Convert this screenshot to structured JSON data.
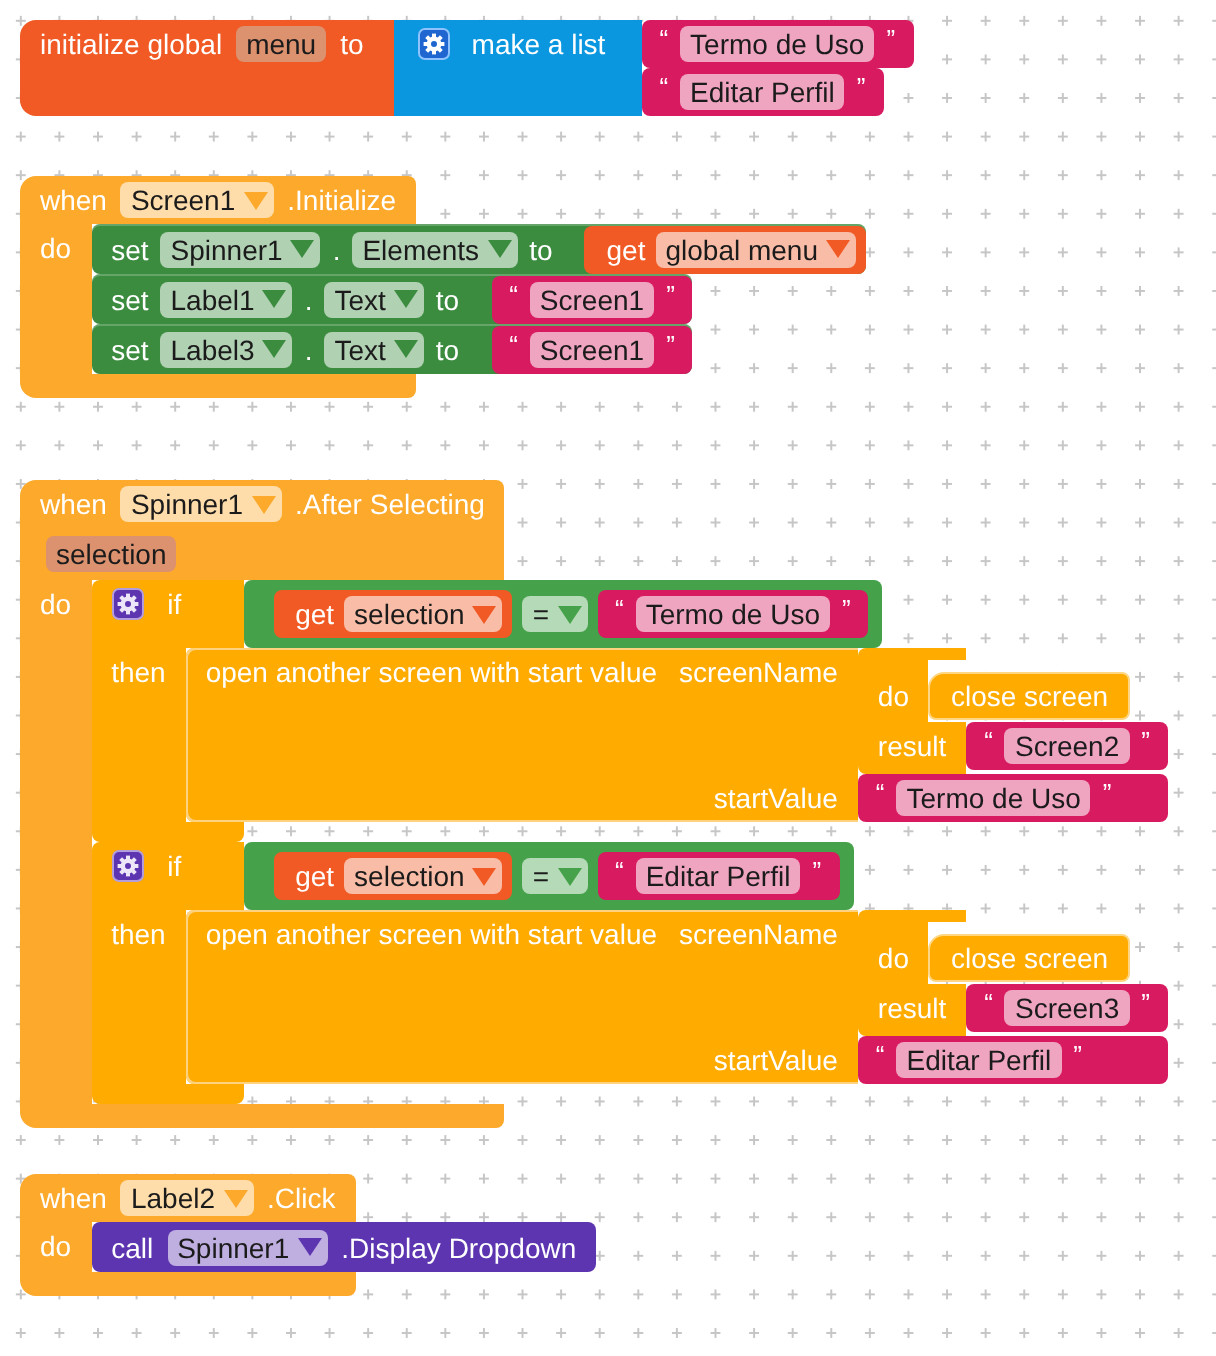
{
  "blocks": [
    {
      "kind": "global_declaration",
      "label": "initialize global",
      "name": "menu",
      "to_label": "to",
      "value": {
        "kind": "make_list",
        "label": "make a list",
        "items": [
          {
            "kind": "text",
            "open_quote": "“",
            "text": "Termo de Uso",
            "close_quote": "”"
          },
          {
            "kind": "text",
            "open_quote": "“",
            "text": "Editar Perfil",
            "close_quote": "”"
          }
        ]
      }
    },
    {
      "kind": "event",
      "when_label": "when",
      "component": "Screen1",
      "event_label": ".Initialize",
      "do_label": "do",
      "statements": [
        {
          "kind": "set",
          "set_label": "set",
          "component": "Spinner1",
          "separator": ".",
          "property": "Elements",
          "to_label": "to",
          "value": {
            "kind": "get",
            "get_label": "get",
            "variable": "global menu"
          }
        },
        {
          "kind": "set",
          "set_label": "set",
          "component": "Label1",
          "separator": ".",
          "property": "Text",
          "to_label": "to",
          "value": {
            "kind": "text",
            "open_quote": "“",
            "text": "Screen1",
            "close_quote": "”"
          }
        },
        {
          "kind": "set",
          "set_label": "set",
          "component": "Label3",
          "separator": ".",
          "property": "Text",
          "to_label": "to",
          "value": {
            "kind": "text",
            "open_quote": "“",
            "text": "Screen1",
            "close_quote": "”"
          }
        }
      ]
    },
    {
      "kind": "event",
      "when_label": "when",
      "component": "Spinner1",
      "event_label": ".After Selecting",
      "parameters": [
        "selection"
      ],
      "do_label": "do",
      "statements": [
        {
          "kind": "if",
          "if_label": "if",
          "condition": {
            "kind": "compare",
            "left": {
              "kind": "get",
              "get_label": "get",
              "variable": "selection"
            },
            "operator": "=",
            "right": {
              "kind": "text",
              "open_quote": "“",
              "text": "Termo de Uso",
              "close_quote": "”"
            }
          },
          "then_label": "then",
          "statements": [
            {
              "kind": "open_screen",
              "label": "open another screen with start value",
              "screen_name_label": "screenName",
              "screen_name": {
                "kind": "do_result",
                "do_label": "do",
                "statements": [
                  {
                    "kind": "close_screen",
                    "label": "close screen"
                  }
                ],
                "result_label": "result",
                "result": {
                  "kind": "text",
                  "open_quote": "“",
                  "text": "Screen2",
                  "close_quote": "”"
                }
              },
              "start_value_label": "startValue",
              "start_value": {
                "kind": "text",
                "open_quote": "“",
                "text": "Termo de Uso",
                "close_quote": "”"
              }
            }
          ]
        },
        {
          "kind": "if",
          "if_label": "if",
          "condition": {
            "kind": "compare",
            "left": {
              "kind": "get",
              "get_label": "get",
              "variable": "selection"
            },
            "operator": "=",
            "right": {
              "kind": "text",
              "open_quote": "“",
              "text": "Editar Perfil",
              "close_quote": "”"
            }
          },
          "then_label": "then",
          "statements": [
            {
              "kind": "open_screen",
              "label": "open another screen with start value",
              "screen_name_label": "screenName",
              "screen_name": {
                "kind": "do_result",
                "do_label": "do",
                "statements": [
                  {
                    "kind": "close_screen",
                    "label": "close screen"
                  }
                ],
                "result_label": "result",
                "result": {
                  "kind": "text",
                  "open_quote": "“",
                  "text": "Screen3",
                  "close_quote": "”"
                }
              },
              "start_value_label": "startValue",
              "start_value": {
                "kind": "text",
                "open_quote": "“",
                "text": "Editar Perfil",
                "close_quote": "”"
              }
            }
          ]
        }
      ]
    },
    {
      "kind": "event",
      "when_label": "when",
      "component": "Label2",
      "event_label": ".Click",
      "do_label": "do",
      "statements": [
        {
          "kind": "call",
          "call_label": "call",
          "component": "Spinner1",
          "method": ".Display Dropdown"
        }
      ]
    }
  ]
}
